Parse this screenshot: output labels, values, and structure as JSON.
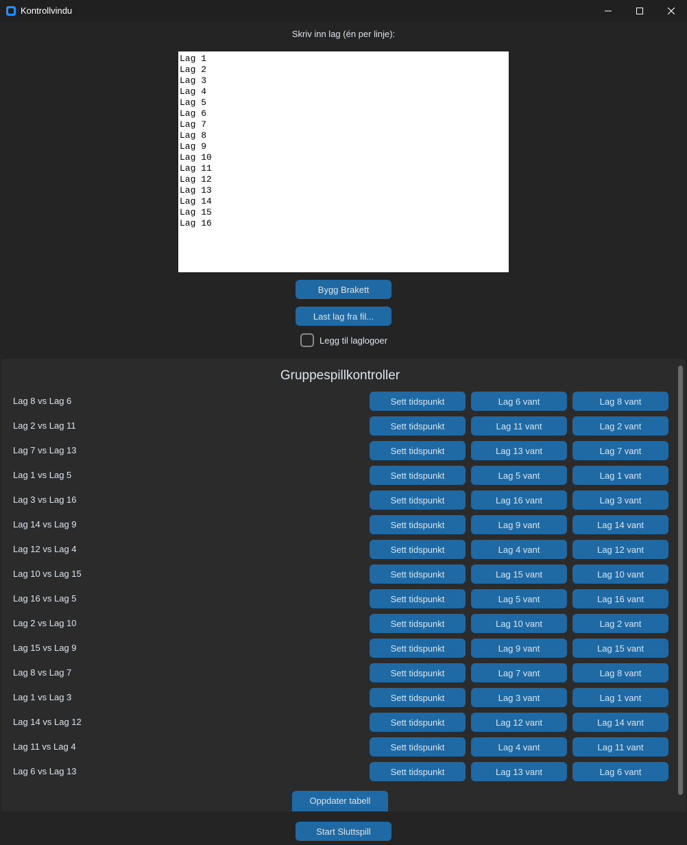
{
  "window": {
    "title": "Kontrollvindu",
    "controls": [
      "minimize-icon",
      "maximize-icon",
      "close-icon"
    ]
  },
  "team_input": {
    "prompt": "Skriv inn lag (én per linje):",
    "value": "Lag 1\nLag 2\nLag 3\nLag 4\nLag 5\nLag 6\nLag 7\nLag 8\nLag 9\nLag 10\nLag 11\nLag 12\nLag 13\nLag 14\nLag 15\nLag 16"
  },
  "buttons": {
    "build": "Bygg Brakett",
    "load": "Last lag fra fil...",
    "add_logos": "Legg til laglogoer",
    "update_table": "Oppdater tabell",
    "start_playoffs": "Start Sluttspill"
  },
  "group_stage": {
    "title": "Gruppespillkontroller",
    "set_time_label": "Sett tidspunkt",
    "matches": [
      {
        "label": "Lag 8 vs Lag 6",
        "win_a": "Lag 6 vant",
        "win_b": "Lag 8 vant"
      },
      {
        "label": "Lag 2 vs Lag 11",
        "win_a": "Lag 11 vant",
        "win_b": "Lag 2 vant"
      },
      {
        "label": "Lag 7 vs Lag 13",
        "win_a": "Lag 13 vant",
        "win_b": "Lag 7 vant"
      },
      {
        "label": "Lag 1 vs Lag 5",
        "win_a": "Lag 5 vant",
        "win_b": "Lag 1 vant"
      },
      {
        "label": "Lag 3 vs Lag 16",
        "win_a": "Lag 16 vant",
        "win_b": "Lag 3 vant"
      },
      {
        "label": "Lag 14 vs Lag 9",
        "win_a": "Lag 9 vant",
        "win_b": "Lag 14 vant"
      },
      {
        "label": "Lag 12 vs Lag 4",
        "win_a": "Lag 4 vant",
        "win_b": "Lag 12 vant"
      },
      {
        "label": "Lag 10 vs Lag 15",
        "win_a": "Lag 15 vant",
        "win_b": "Lag 10 vant"
      },
      {
        "label": "Lag 16 vs Lag 5",
        "win_a": "Lag 5 vant",
        "win_b": "Lag 16 vant"
      },
      {
        "label": "Lag 2 vs Lag 10",
        "win_a": "Lag 10 vant",
        "win_b": "Lag 2 vant"
      },
      {
        "label": "Lag 15 vs Lag 9",
        "win_a": "Lag 9 vant",
        "win_b": "Lag 15 vant"
      },
      {
        "label": "Lag 8 vs Lag 7",
        "win_a": "Lag 7 vant",
        "win_b": "Lag 8 vant"
      },
      {
        "label": "Lag 1 vs Lag 3",
        "win_a": "Lag 3 vant",
        "win_b": "Lag 1 vant"
      },
      {
        "label": "Lag 14 vs Lag 12",
        "win_a": "Lag 12 vant",
        "win_b": "Lag 14 vant"
      },
      {
        "label": "Lag 11 vs Lag 4",
        "win_a": "Lag 4 vant",
        "win_b": "Lag 11 vant"
      },
      {
        "label": "Lag 6 vs Lag 13",
        "win_a": "Lag 13 vant",
        "win_b": "Lag 6 vant"
      }
    ]
  },
  "colors": {
    "accent": "#1f6aa5",
    "background": "#242424",
    "panel": "#2b2b2b",
    "text": "#dce4ee"
  }
}
